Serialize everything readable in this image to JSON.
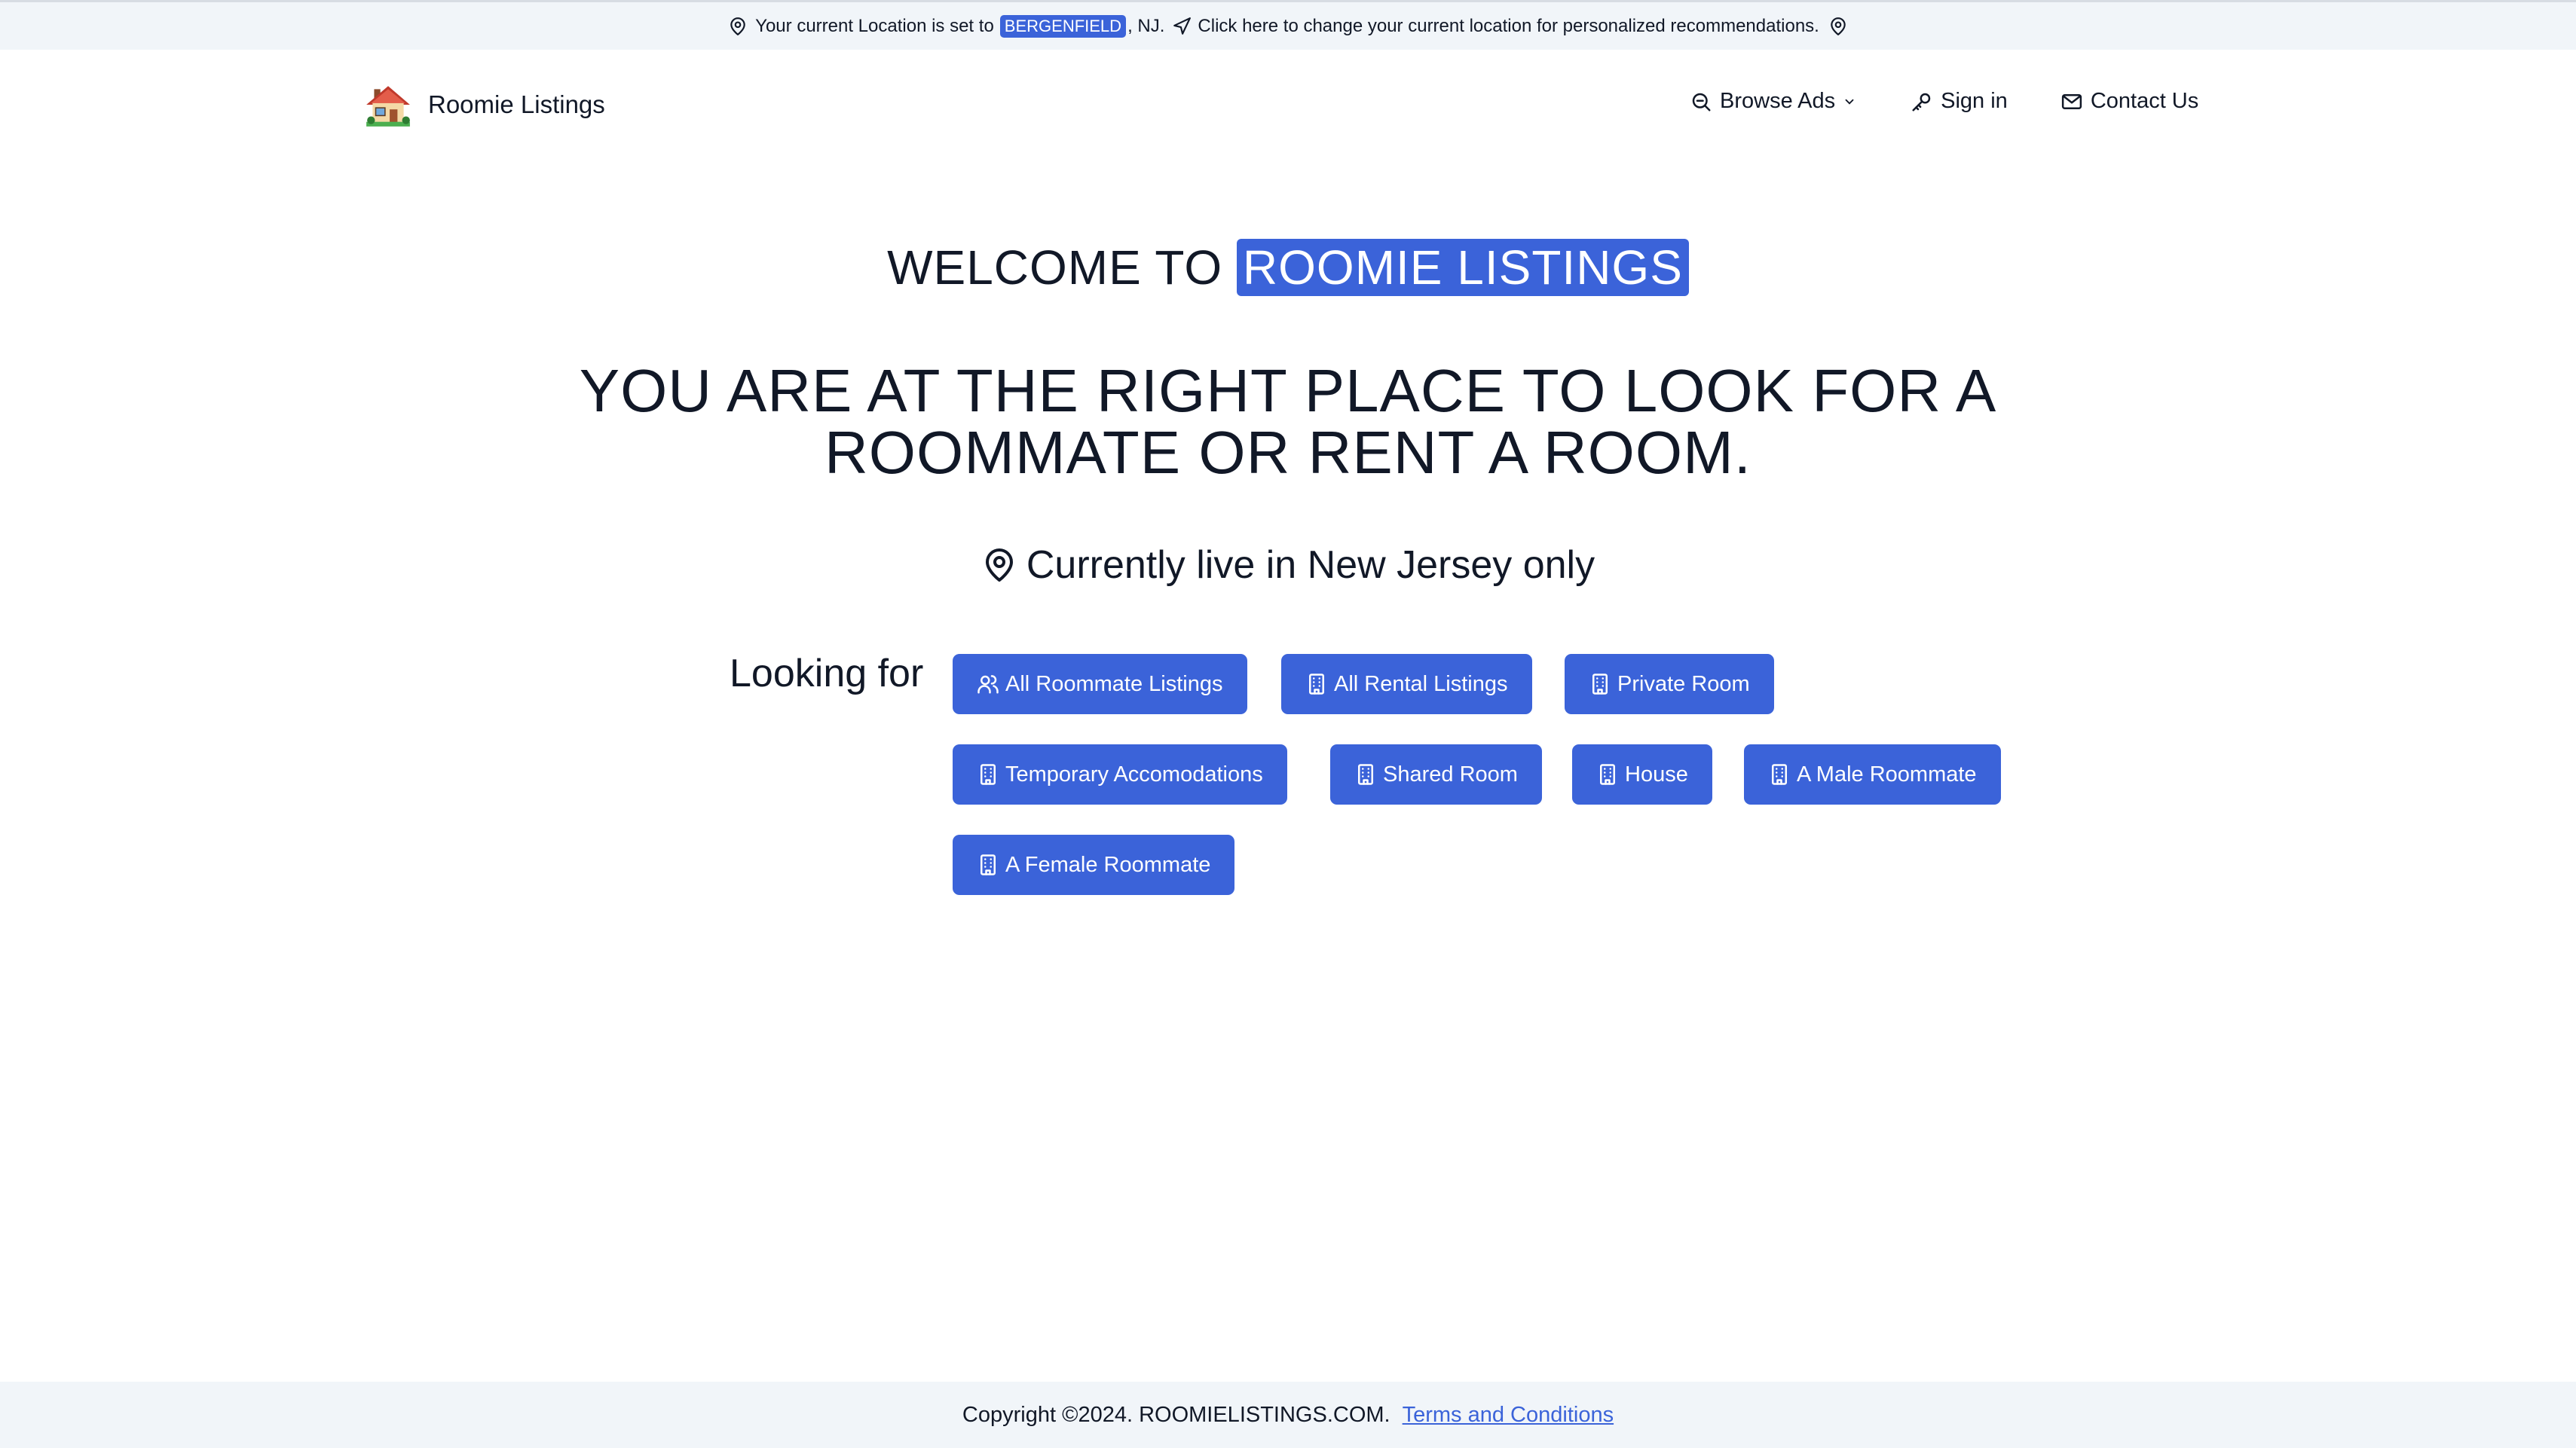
{
  "banner": {
    "prefix": "Your current Location is set to",
    "city": "BERGENFIELD",
    "state_suffix": ", NJ.",
    "change_link": "Click here to change your current location for personalized recommendations."
  },
  "header": {
    "brand": "Roomie Listings",
    "nav": {
      "browse": "Browse Ads",
      "signin": "Sign in",
      "contact": "Contact Us"
    }
  },
  "hero": {
    "welcome_prefix": "WELCOME TO",
    "welcome_highlight": "ROOMIE LISTINGS",
    "headline_line1": "YOU ARE AT THE RIGHT PLACE TO LOOK FOR A",
    "headline_line2": "ROOMMATE OR RENT A ROOM.",
    "live_text": "Currently live in New Jersey only"
  },
  "looking": {
    "label": "Looking for",
    "buttons": [
      {
        "label": "All Roommate Listings",
        "icon": "users-icon"
      },
      {
        "label": "All Rental Listings",
        "icon": "building-icon"
      },
      {
        "label": "Private Room",
        "icon": "building-icon"
      },
      {
        "label": "Temporary Accomodations",
        "icon": "building-icon"
      },
      {
        "label": "Shared Room",
        "icon": "building-icon"
      },
      {
        "label": "House",
        "icon": "building-icon"
      },
      {
        "label": "A Male Roommate",
        "icon": "building-icon"
      },
      {
        "label": "A Female Roommate",
        "icon": "building-icon"
      }
    ]
  },
  "footer": {
    "copyright": "Copyright ©2024. ROOMIELISTINGS.COM.",
    "terms": "Terms and Conditions"
  },
  "colors": {
    "accent": "#3b63d9",
    "band": "#f1f5f9",
    "text": "#111827"
  }
}
